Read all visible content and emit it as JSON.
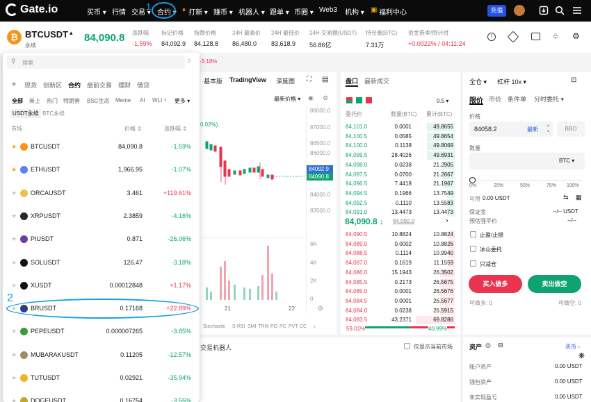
{
  "topnav": {
    "logo": "Gate.io",
    "items": [
      "买币 ▾",
      "行情",
      "交易 ▾",
      "合约 ▾",
      "打新 ▾",
      "赚币 ▾",
      "机器人 ▾",
      "跟单 ▾",
      "币圈 ▾",
      "Web3",
      "机构 ▾",
      "福利中心"
    ],
    "deposit": "充值"
  },
  "ticker": {
    "symbol": "BTCUSDT",
    "symbol_sub": "永续",
    "price": "84,090.8",
    "stats": [
      {
        "label": "涨跌幅",
        "value": "-1.59%"
      },
      {
        "label": "标记价格",
        "value": "84,092.9"
      },
      {
        "label": "指数价格",
        "value": "84,128.8"
      },
      {
        "label": "24H 最高价",
        "value": "86,480.0"
      },
      {
        "label": "24H 最低价",
        "value": "83,618.9"
      },
      {
        "label": "24H 交易额(USDT)",
        "value": "56.86亿"
      },
      {
        "label": "持仓量(BTC)",
        "value": "7.31万"
      },
      {
        "label": "资金费率/倒计时",
        "value": "+0.0022% / 04:11:24"
      }
    ],
    "below_change": "-3.18%"
  },
  "dropdown": {
    "search_placeholder": "搜索",
    "tabs": [
      "现货",
      "创新区",
      "合约",
      "盘前交易",
      "理财",
      "借贷"
    ],
    "chips": [
      "全部",
      "新上",
      "热门",
      "特朗普",
      "BSC生态",
      "Meme",
      "AI",
      "WLI",
      "更多 ▾"
    ],
    "subtabs": [
      "USDT永续",
      "BTC永续"
    ],
    "headers": {
      "market": "市场",
      "price": "价格 ⇕",
      "change": "涨跌幅 ⇕"
    },
    "rows": [
      {
        "sym": "BTCUSDT",
        "price": "84,090.8",
        "change": "-1.59%",
        "fav": true,
        "dir": "down",
        "color": "#f7931a"
      },
      {
        "sym": "ETHUSDT",
        "price": "1,966.95",
        "change": "-1.07%",
        "fav": true,
        "dir": "down",
        "color": "#627eea"
      },
      {
        "sym": "ORCAUSDT",
        "price": "3.461",
        "change": "+119.61%",
        "fav": false,
        "dir": "up",
        "color": "#e8c24a"
      },
      {
        "sym": "XRPUSDT",
        "price": "2.3859",
        "change": "-4.16%",
        "fav": false,
        "dir": "down",
        "color": "#23292f"
      },
      {
        "sym": "PIUSDT",
        "price": "0.871",
        "change": "-26.06%",
        "fav": false,
        "dir": "down",
        "color": "#6b3fa0"
      },
      {
        "sym": "SOLUSDT",
        "price": "126.47",
        "change": "-3.18%",
        "fav": false,
        "dir": "down",
        "color": "#14131a"
      },
      {
        "sym": "XUSDT",
        "price": "0.00012848",
        "change": "+1.17%",
        "fav": false,
        "dir": "up",
        "color": "#111111"
      },
      {
        "sym": "BRUSDT",
        "price": "0.17168",
        "change": "+22.89%",
        "fav": false,
        "dir": "up",
        "color": "#2b3a8c"
      },
      {
        "sym": "PEPEUSDT",
        "price": "0.000007265",
        "change": "-3.85%",
        "fav": false,
        "dir": "down",
        "color": "#3d9a3a"
      },
      {
        "sym": "MUBARAKUSDT",
        "price": "0.11205",
        "change": "-12.57%",
        "fav": false,
        "dir": "down",
        "color": "#a08a66"
      },
      {
        "sym": "TUTUSDT",
        "price": "0.02921",
        "change": "-35.94%",
        "fav": false,
        "dir": "down",
        "color": "#f0b429"
      },
      {
        "sym": "DOGEUSDT",
        "price": "0.16754",
        "change": "-3.55%",
        "fav": false,
        "dir": "down",
        "color": "#c2a633"
      }
    ],
    "annotation_label": "2"
  },
  "annotation_top_label": "1",
  "chart": {
    "tabs": [
      "基本版",
      "TradingView",
      "深度图"
    ],
    "latest_price_sel": "最新价格 ▾",
    "pct_label": "0.02%)",
    "y_ticks": [
      "88000.0",
      "87000.0",
      "86500.0",
      "86000.0",
      "85500.0",
      "85000.0",
      "84500.0",
      "84000.0",
      "83500.0"
    ],
    "price_tags": [
      "84092.9",
      "84090.8"
    ],
    "vol_ticks": [
      "6K",
      "4K",
      "2K",
      "0"
    ],
    "x_ticks": [
      "21",
      "22"
    ],
    "indicators": [
      "Stochastic",
      "S-RSI",
      "SMI",
      "TRIX",
      "PO",
      "PC",
      "PVT",
      "CC"
    ]
  },
  "book": {
    "tabs": [
      "盘口",
      "最新成交"
    ],
    "precision": "0.5 ▾",
    "headers": [
      "委托价",
      "数量(BTC)",
      "累计(BTC)"
    ],
    "asks": [
      [
        "84,101.0",
        "0.0001",
        "49.8655"
      ],
      [
        "84,100.5",
        "0.0585",
        "49.8654"
      ],
      [
        "84,100.0",
        "0.1138",
        "49.8069"
      ],
      [
        "84,099.5",
        "28.4026",
        "49.6931"
      ],
      [
        "84,098.0",
        "0.0238",
        "21.2905"
      ],
      [
        "84,097.5",
        "0.0700",
        "21.2667"
      ],
      [
        "84,096.5",
        "7.4418",
        "21.1967"
      ],
      [
        "84,094.5",
        "0.1966",
        "13.7549"
      ],
      [
        "84,092.5",
        "0.1110",
        "13.5583"
      ],
      [
        "84,091.0",
        "13.4473",
        "13.4473"
      ]
    ],
    "mid_price": "84,090.8 ↓",
    "mid_mark": "84,092.9",
    "bids": [
      [
        "84,090.5",
        "10.8824",
        "10.8824"
      ],
      [
        "84,089.0",
        "0.0002",
        "10.8826"
      ],
      [
        "84,088.5",
        "0.1114",
        "10.9940"
      ],
      [
        "84,087.0",
        "0.1619",
        "11.1559"
      ],
      [
        "84,086.0",
        "15.1943",
        "26.3502"
      ],
      [
        "84,085.5",
        "0.2173",
        "26.5675"
      ],
      [
        "84,085.0",
        "0.0001",
        "26.5676"
      ],
      [
        "84,084.5",
        "0.0001",
        "26.5677"
      ],
      [
        "84,084.0",
        "0.0238",
        "26.5915"
      ],
      [
        "84,083.5",
        "43.2371",
        "69.8286"
      ]
    ],
    "buy_pct": "59.01%",
    "sell_pct": "40.99%",
    "buy_ratio": 0.5901
  },
  "form": {
    "mode": "全仓 ▾",
    "leverage": "杠杆 10x ▾",
    "order_tabs": [
      "限价",
      "市价",
      "条件单",
      "分时委托 ▾"
    ],
    "price_label": "价格",
    "price_value": "84058.2",
    "latest": "最新",
    "bbo": "BBO",
    "qty_label": "数量",
    "qty_unit": "BTC ▾",
    "slider_marks": [
      "0%",
      "25%",
      "50%",
      "75%",
      "100%"
    ],
    "available_label": "可用",
    "available_value": "0.00 USDT",
    "margin_label": "保证金",
    "margin_value": "--/-- USDT",
    "liq_label": "预估强平价",
    "liq_value": "--/--",
    "options": [
      "止盈/止损",
      "冰山委托",
      "只减仓"
    ],
    "buy": "买入做多",
    "sell": "卖出做空",
    "can_long": "可做多: 0",
    "can_short": "可做空: 0"
  },
  "bottom": {
    "left_tab": "交易机器人",
    "only_current": "仅显示当前市场",
    "assets_title": "资产",
    "buy_coin": "买币 ›",
    "rows": [
      {
        "label": "账户资产",
        "value": "0.00 USDT"
      },
      {
        "label": "钱包资产",
        "value": "0.00 USDT"
      },
      {
        "label": "未实现盈亏",
        "value": "0.00 USDT"
      }
    ]
  }
}
